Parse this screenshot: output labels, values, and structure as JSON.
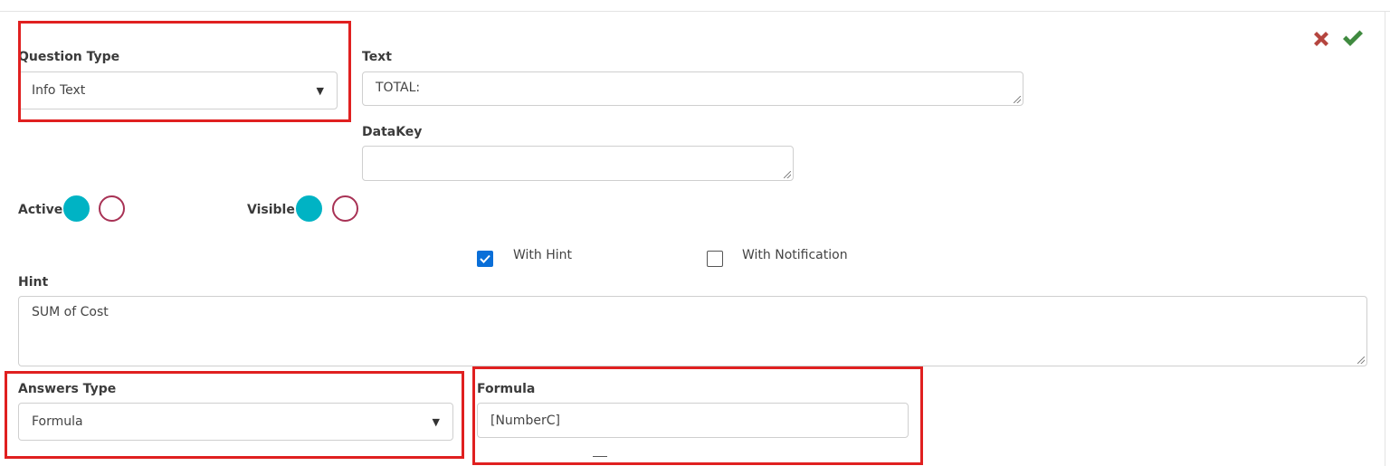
{
  "question_type": {
    "label": "Question Type",
    "value": "Info Text"
  },
  "text_field": {
    "label": "Text",
    "value": "TOTAL:"
  },
  "datakey_field": {
    "label": "DataKey",
    "value": ""
  },
  "active": {
    "label": "Active"
  },
  "visible": {
    "label": "Visible"
  },
  "with_hint": {
    "label": "With Hint",
    "checked": true
  },
  "with_notification": {
    "label": "With Notification",
    "checked": false
  },
  "hint_field": {
    "label": "Hint",
    "value": "SUM of Cost"
  },
  "answers_type": {
    "label": "Answers Type",
    "value": "Formula"
  },
  "formula_field": {
    "label": "Formula",
    "value": "[NumberC]"
  },
  "colors": {
    "accent_teal": "#00b3c4",
    "radio_off_border": "#a83255",
    "checkbox_blue": "#0a6fd8",
    "highlight_red": "#e02020",
    "cancel_red": "#b5453f",
    "confirm_green": "#3f8a3f"
  },
  "icons": {
    "cancel": "close-icon",
    "confirm": "checkmark-icon"
  }
}
